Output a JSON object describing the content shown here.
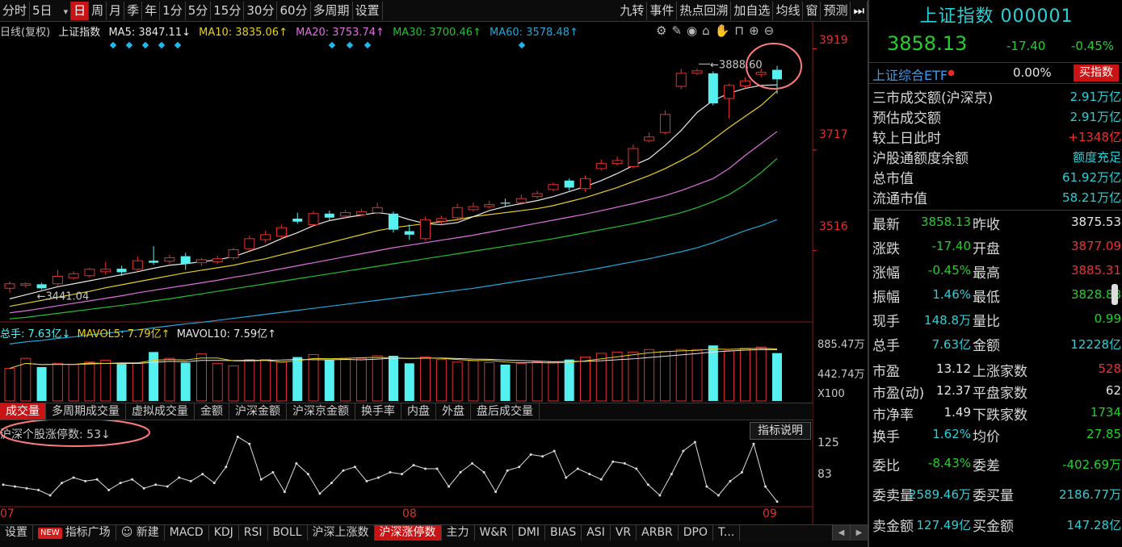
{
  "toolbar": {
    "items": [
      "分时",
      "5日",
      "日",
      "周",
      "月",
      "季",
      "年",
      "1分",
      "5分",
      "15分",
      "30分",
      "60分",
      "多周期",
      "设置"
    ],
    "active_index": 2,
    "right_items": [
      "九转",
      "事件",
      "热点回溯",
      "加自选",
      "均线",
      "窗",
      "预测"
    ],
    "play_icon": "play-icon"
  },
  "chart_legend": {
    "prefix": "日线(复权)",
    "name": "上证指数",
    "ma5": "MA5: 3847.11↓",
    "ma10": "MA10: 3835.06↑",
    "ma20": "MA20: 3753.74↑",
    "ma30": "MA30: 3700.46↑",
    "ma60": "MA60: 3578.48↑"
  },
  "tool_icons": [
    "settings-icon",
    "pen-icon",
    "eye-icon",
    "basket-icon",
    "hand-icon",
    "lock-icon",
    "zoom-in-icon",
    "zoom-out-icon"
  ],
  "price_axis": [
    "3919",
    "3717",
    "3516"
  ],
  "annotations": {
    "high": "3888.60",
    "low": "3441.04"
  },
  "volume_legend": {
    "total": "总手: 7.63亿↓",
    "mavol5": "MAVOL5: 7.79亿↑",
    "mavol10": "MAVOL10: 7.59亿↑"
  },
  "volume_axis": [
    "885.47万",
    "442.74万",
    "X100"
  ],
  "volume_tabs": [
    "成交量",
    "多周期成交量",
    "虚拟成交量",
    "金额",
    "沪深金额",
    "沪深京金额",
    "换手率",
    "内盘",
    "外盘",
    "盘后成交量"
  ],
  "volume_tabs_active": 0,
  "indicator": {
    "legend": "沪深个股涨停数: 53↓",
    "button": "指标说明",
    "axis": [
      "125",
      "83"
    ]
  },
  "date_axis": [
    "07",
    "08",
    "09"
  ],
  "bottom_tabs": {
    "settings": "设置",
    "new_badge": "NEW",
    "plaza": "指标广场",
    "new_label": "新建",
    "items": [
      "MACD",
      "KDJ",
      "RSI",
      "BOLL",
      "沪深上涨数",
      "沪深涨停数",
      "主力",
      "W&R",
      "DMI",
      "BIAS",
      "ASI",
      "VR",
      "ARBR",
      "DPO",
      "T..."
    ],
    "active": "沪深涨停数"
  },
  "panel": {
    "title": "上证指数 000001",
    "price": "3858.13",
    "change": "-17.40",
    "change_pct": "-0.45%",
    "etf_name": "上证综合ETF",
    "etf_pct": "0.00%",
    "buy_button": "买指数",
    "info": [
      {
        "label": "三市成交额(沪深京)",
        "value": "2.91万亿",
        "color": "cyan"
      },
      {
        "label": "预估成交额",
        "value": "2.91万亿",
        "color": "cyan"
      },
      {
        "label": "较上日此时",
        "value": "+1348亿",
        "color": "red"
      },
      {
        "label": "沪股通额度余额",
        "value": "额度充足",
        "color": "cyan"
      },
      {
        "label": "总市值",
        "value": "61.92万亿",
        "color": "cyan"
      },
      {
        "label": "流通市值",
        "value": "58.21万亿",
        "color": "cyan"
      }
    ],
    "quotes": [
      {
        "l1": "最新",
        "v1": "3858.13",
        "c1": "green",
        "l2": "昨收",
        "v2": "3875.53",
        "c2": "white"
      },
      {
        "l1": "涨跌",
        "v1": "-17.40",
        "c1": "green",
        "l2": "开盘",
        "v2": "3877.09",
        "c2": "red"
      },
      {
        "l1": "涨幅",
        "v1": "-0.45%",
        "c1": "green",
        "l2": "最高",
        "v2": "3885.31",
        "c2": "red"
      },
      {
        "l1": "振幅",
        "v1": "1.46%",
        "c1": "cyan",
        "l2": "最低",
        "v2": "3828.88",
        "c2": "green"
      },
      {
        "l1": "现手",
        "v1": "148.8万",
        "c1": "cyan",
        "l2": "量比",
        "v2": "0.99",
        "c2": "green"
      },
      {
        "l1": "总手",
        "v1": "7.63亿",
        "c1": "cyan",
        "l2": "金额",
        "v2": "12228亿",
        "c2": "cyan"
      },
      {
        "l1": "市盈",
        "v1": "13.12",
        "c1": "white",
        "l2": "上涨家数",
        "v2": "528",
        "c2": "red"
      },
      {
        "l1": "市盈(动)",
        "v1": "12.37",
        "c1": "white",
        "l2": "平盘家数",
        "v2": "62",
        "c2": "white"
      },
      {
        "l1": "市净率",
        "v1": "1.49",
        "c1": "white",
        "l2": "下跌家数",
        "v2": "1734",
        "c2": "green"
      },
      {
        "l1": "换手",
        "v1": "1.62%",
        "c1": "cyan",
        "l2": "均价",
        "v2": "27.85",
        "c2": "green"
      },
      {
        "l1": "委比",
        "v1": "-8.43%",
        "c1": "green",
        "l2": "委差",
        "v2": "-402.69万",
        "c2": "green"
      },
      {
        "l1": "委卖量",
        "v1": "2589.46万",
        "c1": "cyan",
        "l2": "委买量",
        "v2": "2186.77万",
        "c2": "cyan"
      },
      {
        "l1": "卖金额",
        "v1": "127.49亿",
        "c1": "cyan",
        "l2": "买金额",
        "v2": "147.28亿",
        "c2": "cyan"
      }
    ]
  },
  "colors": {
    "up": "#e53030",
    "down": "#55f0f0",
    "ma5": "#e8e8e8",
    "ma10": "#e8d020",
    "ma20": "#e070e0",
    "ma30": "#22c030",
    "ma60": "#20a8d8",
    "accent_red": "#c81414"
  },
  "chart_data": {
    "type": "candlestick",
    "price_axis_ticks": [
      3919,
      3717,
      3516
    ],
    "ylim": [
      3390,
      3960
    ],
    "candles": [
      {
        "o": 3441,
        "c": 3450,
        "h": 3455,
        "l": 3432
      },
      {
        "o": 3447,
        "c": 3450,
        "h": 3453,
        "l": 3442
      },
      {
        "o": 3449,
        "c": 3441,
        "h": 3452,
        "l": 3438
      },
      {
        "o": 3450,
        "c": 3465,
        "h": 3478,
        "l": 3446
      },
      {
        "o": 3462,
        "c": 3470,
        "h": 3475,
        "l": 3458
      },
      {
        "o": 3466,
        "c": 3479,
        "h": 3482,
        "l": 3462
      },
      {
        "o": 3474,
        "c": 3479,
        "h": 3494,
        "l": 3468
      },
      {
        "o": 3480,
        "c": 3473,
        "h": 3486,
        "l": 3466
      },
      {
        "o": 3479,
        "c": 3496,
        "h": 3505,
        "l": 3476
      },
      {
        "o": 3496,
        "c": 3492,
        "h": 3525,
        "l": 3488
      },
      {
        "o": 3495,
        "c": 3502,
        "h": 3508,
        "l": 3490
      },
      {
        "o": 3505,
        "c": 3490,
        "h": 3512,
        "l": 3478
      },
      {
        "o": 3492,
        "c": 3498,
        "h": 3502,
        "l": 3486
      },
      {
        "o": 3494,
        "c": 3500,
        "h": 3506,
        "l": 3489
      },
      {
        "o": 3502,
        "c": 3518,
        "h": 3522,
        "l": 3498
      },
      {
        "o": 3520,
        "c": 3540,
        "h": 3546,
        "l": 3516
      },
      {
        "o": 3538,
        "c": 3548,
        "h": 3556,
        "l": 3532
      },
      {
        "o": 3545,
        "c": 3562,
        "h": 3568,
        "l": 3540
      },
      {
        "o": 3580,
        "c": 3574,
        "h": 3592,
        "l": 3570
      },
      {
        "o": 3568,
        "c": 3590,
        "h": 3595,
        "l": 3566
      },
      {
        "o": 3590,
        "c": 3582,
        "h": 3596,
        "l": 3576
      },
      {
        "o": 3585,
        "c": 3592,
        "h": 3598,
        "l": 3580
      },
      {
        "o": 3588,
        "c": 3594,
        "h": 3600,
        "l": 3584
      },
      {
        "o": 3592,
        "c": 3602,
        "h": 3612,
        "l": 3588
      },
      {
        "o": 3590,
        "c": 3558,
        "h": 3594,
        "l": 3552
      },
      {
        "o": 3555,
        "c": 3548,
        "h": 3568,
        "l": 3538
      },
      {
        "o": 3540,
        "c": 3578,
        "h": 3584,
        "l": 3536
      },
      {
        "o": 3575,
        "c": 3580,
        "h": 3586,
        "l": 3568
      },
      {
        "o": 3582,
        "c": 3602,
        "h": 3610,
        "l": 3578
      },
      {
        "o": 3598,
        "c": 3604,
        "h": 3612,
        "l": 3594
      },
      {
        "o": 3604,
        "c": 3608,
        "h": 3616,
        "l": 3600
      },
      {
        "o": 3612,
        "c": 3610,
        "h": 3620,
        "l": 3604
      },
      {
        "o": 3612,
        "c": 3620,
        "h": 3628,
        "l": 3608
      },
      {
        "o": 3624,
        "c": 3630,
        "h": 3636,
        "l": 3620
      },
      {
        "o": 3638,
        "c": 3648,
        "h": 3652,
        "l": 3634
      },
      {
        "o": 3656,
        "c": 3642,
        "h": 3660,
        "l": 3636
      },
      {
        "o": 3640,
        "c": 3660,
        "h": 3666,
        "l": 3634
      },
      {
        "o": 3680,
        "c": 3690,
        "h": 3698,
        "l": 3676
      },
      {
        "o": 3690,
        "c": 3696,
        "h": 3704,
        "l": 3686
      },
      {
        "o": 3684,
        "c": 3720,
        "h": 3728,
        "l": 3680
      },
      {
        "o": 3736,
        "c": 3743,
        "h": 3752,
        "l": 3732
      },
      {
        "o": 3752,
        "c": 3788,
        "h": 3796,
        "l": 3748
      },
      {
        "o": 3844,
        "c": 3870,
        "h": 3879,
        "l": 3838
      },
      {
        "o": 3870,
        "c": 3875,
        "h": 3880,
        "l": 3866
      },
      {
        "o": 3870,
        "c": 3810,
        "h": 3874,
        "l": 3806
      },
      {
        "o": 3820,
        "c": 3846,
        "h": 3850,
        "l": 3780
      },
      {
        "o": 3845,
        "c": 3855,
        "h": 3862,
        "l": 3840
      },
      {
        "o": 3868,
        "c": 3872,
        "h": 3880,
        "l": 3862
      },
      {
        "o": 3877,
        "c": 3858,
        "h": 3885,
        "l": 3829
      }
    ],
    "ma5": [
      3420,
      3428,
      3436,
      3444,
      3450,
      3456,
      3462,
      3468,
      3474,
      3481,
      3487,
      3490,
      3494,
      3498,
      3504,
      3515,
      3526,
      3540,
      3552,
      3566,
      3576,
      3582,
      3587,
      3592,
      3588,
      3578,
      3570,
      3568,
      3572,
      3584,
      3596,
      3604,
      3610,
      3616,
      3624,
      3634,
      3644,
      3656,
      3670,
      3686,
      3700,
      3726,
      3756,
      3792,
      3816,
      3830,
      3840,
      3846,
      3847
    ],
    "ma10": [
      3405,
      3411,
      3417,
      3423,
      3429,
      3435,
      3442,
      3448,
      3454,
      3460,
      3466,
      3472,
      3477,
      3482,
      3487,
      3494,
      3500,
      3508,
      3516,
      3524,
      3532,
      3540,
      3548,
      3556,
      3562,
      3566,
      3570,
      3574,
      3578,
      3584,
      3588,
      3592,
      3596,
      3600,
      3606,
      3614,
      3622,
      3632,
      3642,
      3654,
      3666,
      3680,
      3696,
      3714,
      3738,
      3762,
      3784,
      3806,
      3835
    ],
    "ma20": [
      3392,
      3396,
      3401,
      3406,
      3411,
      3416,
      3421,
      3426,
      3432,
      3437,
      3442,
      3447,
      3452,
      3457,
      3463,
      3468,
      3474,
      3480,
      3486,
      3492,
      3498,
      3504,
      3510,
      3516,
      3522,
      3527,
      3532,
      3537,
      3542,
      3547,
      3553,
      3559,
      3565,
      3571,
      3577,
      3583,
      3589,
      3596,
      3603,
      3610,
      3618,
      3626,
      3636,
      3648,
      3660,
      3680,
      3706,
      3730,
      3754
    ],
    "ma30": [
      3380,
      3383,
      3387,
      3391,
      3395,
      3399,
      3403,
      3407,
      3411,
      3416,
      3420,
      3425,
      3430,
      3435,
      3440,
      3445,
      3450,
      3455,
      3460,
      3465,
      3470,
      3475,
      3480,
      3485,
      3490,
      3495,
      3500,
      3505,
      3510,
      3515,
      3520,
      3525,
      3530,
      3535,
      3540,
      3546,
      3552,
      3558,
      3564,
      3570,
      3577,
      3584,
      3592,
      3602,
      3614,
      3628,
      3648,
      3672,
      3700
    ],
    "ma60": [
      3330,
      3334,
      3337,
      3341,
      3344,
      3348,
      3351,
      3355,
      3358,
      3362,
      3366,
      3370,
      3373,
      3377,
      3381,
      3385,
      3389,
      3393,
      3397,
      3401,
      3405,
      3409,
      3413,
      3417,
      3421,
      3425,
      3429,
      3433,
      3437,
      3441,
      3446,
      3451,
      3456,
      3461,
      3466,
      3471,
      3476,
      3482,
      3488,
      3494,
      3500,
      3507,
      3514,
      3522,
      3532,
      3544,
      3556,
      3566,
      3578
    ],
    "volume": [
      5.2,
      6.8,
      5.4,
      6.0,
      5.8,
      6.2,
      6.5,
      5.9,
      6.0,
      7.8,
      6.8,
      6.1,
      7.5,
      6.0,
      5.6,
      6.6,
      6.6,
      6.2,
      7.0,
      7.4,
      6.5,
      6.8,
      6.8,
      7.2,
      7.2,
      6.0,
      7.0,
      6.6,
      6.2,
      6.4,
      6.1,
      5.8,
      6.0,
      6.2,
      6.2,
      6.6,
      7.0,
      7.6,
      7.8,
      7.8,
      8.2,
      7.9,
      8.2,
      8.2,
      8.85,
      8.0,
      8.4,
      8.6,
      7.63
    ],
    "volume_axis": [
      885.47,
      442.74
    ],
    "limit_up_count": [
      72,
      70,
      68,
      66,
      60,
      74,
      80,
      76,
      78,
      66,
      74,
      78,
      68,
      72,
      70,
      80,
      76,
      84,
      74,
      92,
      126,
      118,
      78,
      86,
      64,
      96,
      84,
      62,
      74,
      88,
      92,
      76,
      80,
      86,
      84,
      94,
      90,
      90,
      70,
      86,
      96,
      86,
      64,
      88,
      92,
      106,
      104,
      110,
      80,
      90,
      84,
      78,
      98,
      96,
      90,
      72,
      60,
      84,
      110,
      120,
      70,
      60,
      76,
      86,
      118,
      70,
      53
    ],
    "indicator_axis": [
      125,
      83
    ],
    "date_ticks": [
      "07",
      "08",
      "09"
    ]
  }
}
